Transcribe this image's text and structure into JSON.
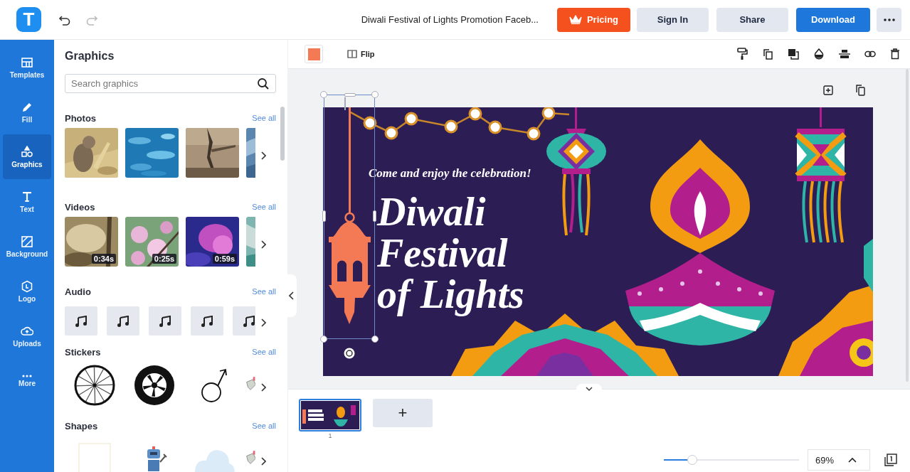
{
  "header": {
    "logo_letter": "T",
    "document_title": "Diwali Festival of Lights Promotion Faceb...",
    "buttons": [
      {
        "kind": "pricing",
        "label": "Pricing"
      },
      {
        "kind": "plain",
        "label": "Sign In"
      },
      {
        "kind": "plain",
        "label": "Share"
      },
      {
        "kind": "primary",
        "label": "Download"
      },
      {
        "kind": "more"
      }
    ]
  },
  "rail": [
    {
      "kind": "templates",
      "label": "Templates",
      "selected": false
    },
    {
      "kind": "fill",
      "label": "Fill",
      "selected": false
    },
    {
      "kind": "graphics",
      "label": "Graphics",
      "selected": true
    },
    {
      "kind": "text",
      "label": "Text",
      "selected": false
    },
    {
      "kind": "background",
      "label": "Background",
      "selected": false
    },
    {
      "kind": "logo",
      "label": "Logo",
      "selected": false
    },
    {
      "kind": "uploads",
      "label": "Uploads",
      "selected": false
    },
    {
      "kind": "more",
      "label": "More",
      "selected": false
    }
  ],
  "panel": {
    "title": "Graphics",
    "search": {
      "placeholder": "Search graphics"
    },
    "sections": [
      {
        "kind": "photos",
        "title": "Photos",
        "see_all": "See all",
        "items": [
          {
            "kind": "picture"
          },
          {
            "kind": "picture"
          },
          {
            "kind": "picture"
          },
          {
            "kind": "picture"
          }
        ]
      },
      {
        "kind": "videos",
        "title": "Videos",
        "see_all": "See all",
        "items": [
          {
            "kind": "picture",
            "duration": "0:34s"
          },
          {
            "kind": "picture",
            "duration": "0:25s"
          },
          {
            "kind": "picture",
            "duration": "0:59s"
          },
          {
            "kind": "picture"
          }
        ]
      },
      {
        "kind": "audio",
        "title": "Audio",
        "see_all": "See all",
        "items": [
          {
            "kind": "audio"
          },
          {
            "kind": "audio"
          },
          {
            "kind": "audio"
          },
          {
            "kind": "audio"
          },
          {
            "kind": "audio"
          }
        ]
      },
      {
        "kind": "stickers",
        "title": "Stickers",
        "see_all": "See all",
        "items": [
          {
            "kind": "wheel"
          },
          {
            "kind": "tire"
          },
          {
            "kind": "male-sign"
          },
          {
            "kind": "hand"
          }
        ]
      },
      {
        "kind": "shapes",
        "title": "Shapes",
        "see_all": "See all",
        "items": [
          {
            "kind": "frame"
          },
          {
            "kind": "robot"
          },
          {
            "kind": "cloud"
          },
          {
            "kind": "hand"
          }
        ]
      }
    ]
  },
  "toolbar": {
    "swatch": {
      "color": "#f47a55"
    },
    "flip_label": "Flip"
  },
  "design": {
    "subtitle": "Come and enjoy the celebration!",
    "title_lines": [
      "Diwali",
      "Festival",
      "of Lights"
    ]
  },
  "pages": [
    {
      "number": "1",
      "selected": true
    }
  ],
  "add_page": "+",
  "zoom": {
    "level": 0.21,
    "reading": "69%"
  }
}
